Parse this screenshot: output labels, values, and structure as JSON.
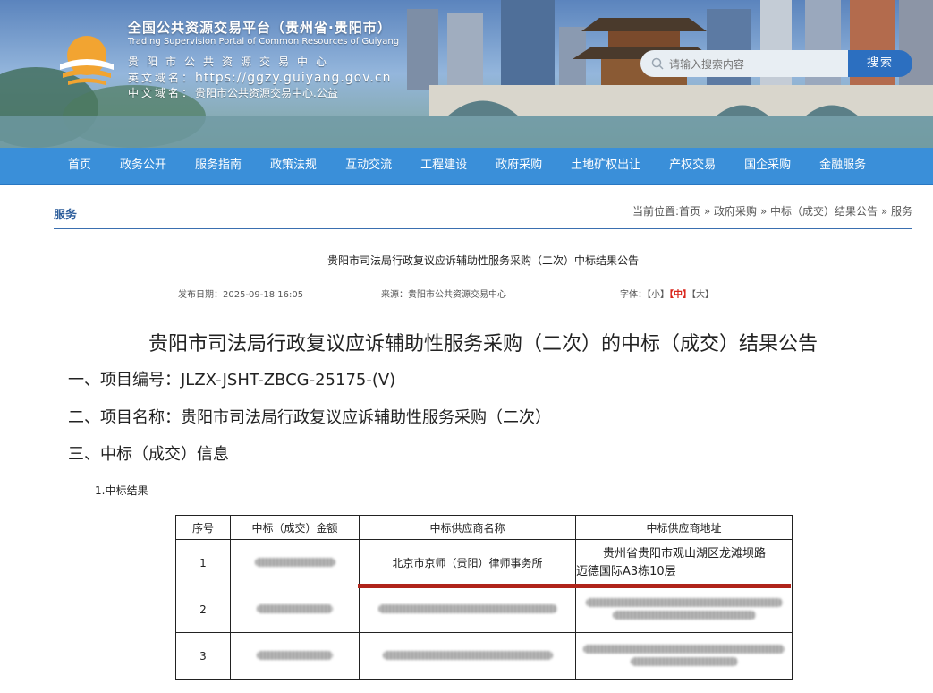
{
  "header": {
    "title": "全国公共资源交易平台（贵州省·贵阳市）",
    "subtitle_en": "Trading Supervision Portal of Common Resources of Guiyang",
    "org_cn": "贵阳市公共资源交易中心",
    "domain_en_label": "英文域名：",
    "domain_en_value": "https://ggzy.guiyang.gov.cn",
    "domain_cn_label": "中文域名：",
    "domain_cn_value": "贵阳市公共资源交易中心.公益",
    "search_placeholder": "请输入搜索内容",
    "search_button": "搜索"
  },
  "nav": {
    "items": [
      "首页",
      "政务公开",
      "服务指南",
      "政策法规",
      "互动交流",
      "工程建设",
      "政府采购",
      "土地矿权出让",
      "产权交易",
      "国企采购",
      "金融服务"
    ]
  },
  "section": {
    "title": "服务",
    "breadcrumb": {
      "prefix": "当前位置:",
      "items": [
        "首页",
        "政府采购",
        "中标（成交）结果公告",
        "服务"
      ],
      "sep": " » "
    }
  },
  "article": {
    "title": "贵阳市司法局行政复议应诉辅助性服务采购（二次）中标结果公告",
    "publish_date": "发布日期：2025-09-18 16:05",
    "source": "来源：贵阳市公共资源交易中心",
    "font_label": "字体：",
    "font_small": "【小】",
    "font_medium": "【中】",
    "font_large": "【大】"
  },
  "document": {
    "heading": "贵阳市司法局行政复议应诉辅助性服务采购（二次）的中标（成交）结果公告",
    "line1": "一、项目编号：JLZX-JSHT-ZBCG-25175-(V)",
    "line2": "二、项目名称：贵阳市司法局行政复议应诉辅助性服务采购（二次）",
    "line3": "三、中标（成交）信息",
    "sub_label": "1.中标结果",
    "table": {
      "headers": [
        "序号",
        "中标（成交）金额",
        "中标供应商名称",
        "中标供应商地址"
      ],
      "rows": [
        {
          "no": "1",
          "supplier": "北京市京师（贵阳）律师事务所",
          "address_line1": "贵州省贵阳市观山湖区龙滩坝路",
          "address_line2": "迈德国际A3栋10层"
        },
        {
          "no": "2"
        },
        {
          "no": "3"
        }
      ]
    }
  }
}
